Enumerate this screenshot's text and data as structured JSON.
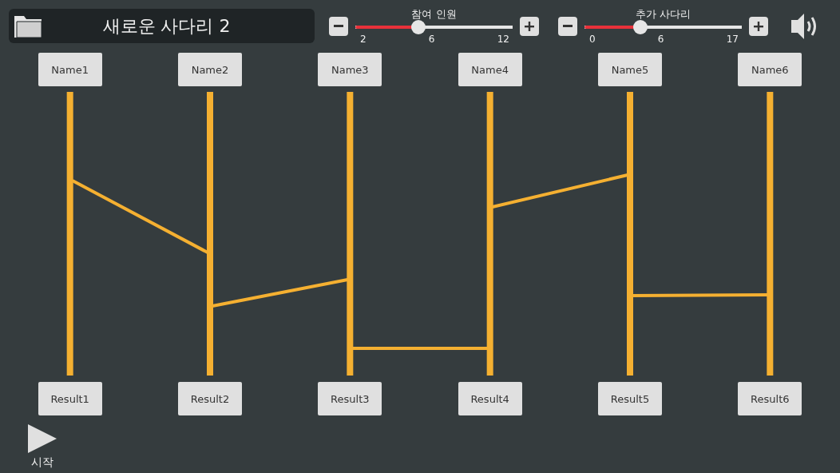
{
  "title": "새로운 사다리 2",
  "sliders": [
    {
      "label": "참여 인원",
      "level": 0.4,
      "ticks": [
        "2",
        "6",
        "12"
      ]
    },
    {
      "label": "추가 사다리",
      "level": 0.353,
      "ticks": [
        "0",
        "6",
        "17"
      ]
    }
  ],
  "sound_on": true,
  "names": [
    "Name1",
    "Name2",
    "Name3",
    "Name4",
    "Name5",
    "Name6"
  ],
  "results": [
    "Result1",
    "Result2",
    "Result3",
    "Result4",
    "Result5",
    "Result6"
  ],
  "start_label": "시작"
}
